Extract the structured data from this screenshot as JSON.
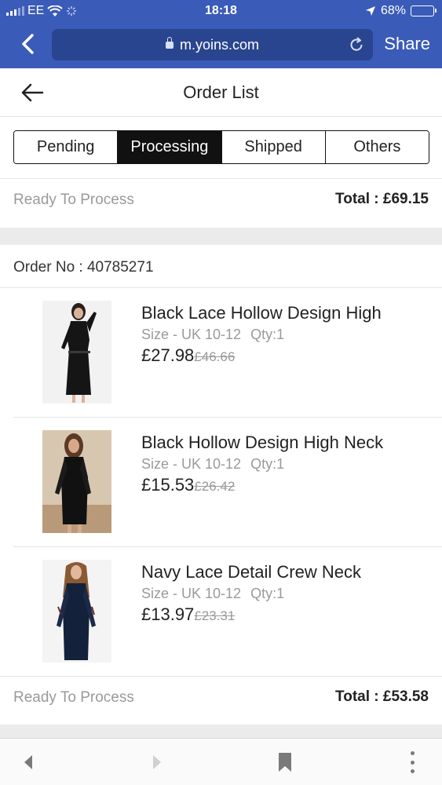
{
  "status_bar": {
    "carrier": "EE",
    "time": "18:18",
    "battery_percent": "68%",
    "battery_level": 0.68
  },
  "browser": {
    "url": "m.yoins.com",
    "share_label": "Share",
    "accent_color": "#3a5bb8"
  },
  "header": {
    "title": "Order List"
  },
  "tabs": [
    {
      "label": "Pending",
      "active": false
    },
    {
      "label": "Processing",
      "active": true
    },
    {
      "label": "Shipped",
      "active": false
    },
    {
      "label": "Others",
      "active": false
    }
  ],
  "summary_top": {
    "status": "Ready To Process",
    "total": "Total : £69.15"
  },
  "order": {
    "order_no": "Order No : 40785271",
    "items": [
      {
        "title": "Black Lace Hollow Design High",
        "size": "Size - UK 10-12",
        "qty": "Qty:1",
        "price": "£27.98",
        "original_price": "£46.66"
      },
      {
        "title": "Black Hollow Design High Neck",
        "size": "Size - UK 10-12",
        "qty": "Qty:1",
        "price": "£15.53",
        "original_price": "£26.42"
      },
      {
        "title": "Navy Lace Detail Crew Neck",
        "size": "Size - UK 10-12",
        "qty": "Qty:1",
        "price": "£13.97",
        "original_price": "£23.31"
      }
    ],
    "status": "Ready To Process",
    "total": "Total : £53.58"
  },
  "toolbar": {
    "icons": [
      "back-arrow-icon",
      "forward-arrow-icon",
      "bookmark-icon",
      "more-vertical-icon"
    ]
  }
}
